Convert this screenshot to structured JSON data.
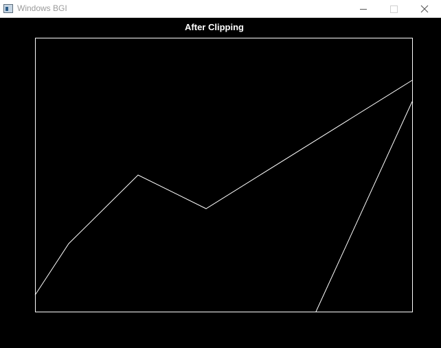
{
  "window": {
    "title": "Windows BGI",
    "icon": "app-window-icon",
    "controls": {
      "minimize_icon": "minimize-icon",
      "maximize_icon": "maximize-icon",
      "close_icon": "close-icon"
    }
  },
  "canvas": {
    "heading": "After Clipping",
    "background": "#000000",
    "stroke": "#ffffff"
  }
}
